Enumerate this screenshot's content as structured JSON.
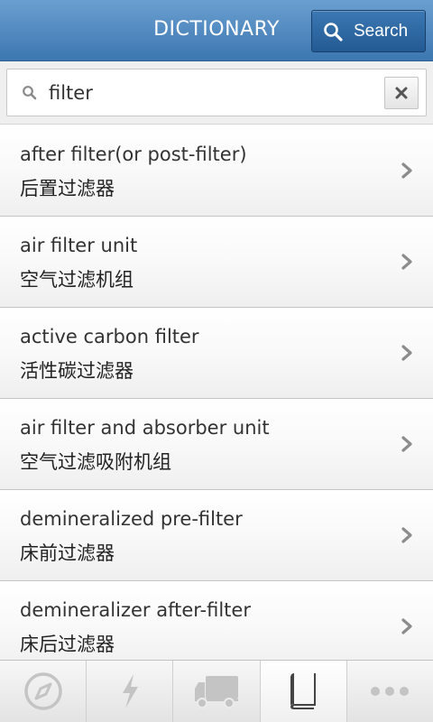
{
  "header": {
    "title": "DICTIONARY",
    "search_button_label": "Search"
  },
  "search": {
    "value": "filter",
    "placeholder": ""
  },
  "results": [
    {
      "english": "after filter(or post-filter)",
      "chinese": "后置过滤器"
    },
    {
      "english": "air filter unit",
      "chinese": "空气过滤机组"
    },
    {
      "english": "active carbon filter",
      "chinese": "活性碳过滤器"
    },
    {
      "english": "air filter and absorber unit",
      "chinese": "空气过滤吸附机组"
    },
    {
      "english": "demineralized pre-filter",
      "chinese": "床前过滤器"
    },
    {
      "english": "demineralizer after-filter",
      "chinese": "床后过滤器"
    }
  ],
  "tabbar": {
    "tabs": [
      {
        "icon": "compass-icon",
        "active": false
      },
      {
        "icon": "lightning-icon",
        "active": false
      },
      {
        "icon": "truck-icon",
        "active": false
      },
      {
        "icon": "book-icon",
        "active": true
      },
      {
        "icon": "more-icon",
        "active": false
      }
    ]
  },
  "colors": {
    "header_top": "#6a9fd0",
    "header_bottom": "#3d77b1",
    "search_button": "#235a93",
    "icon_gray": "#c4c4c4",
    "icon_active": "#444444"
  }
}
